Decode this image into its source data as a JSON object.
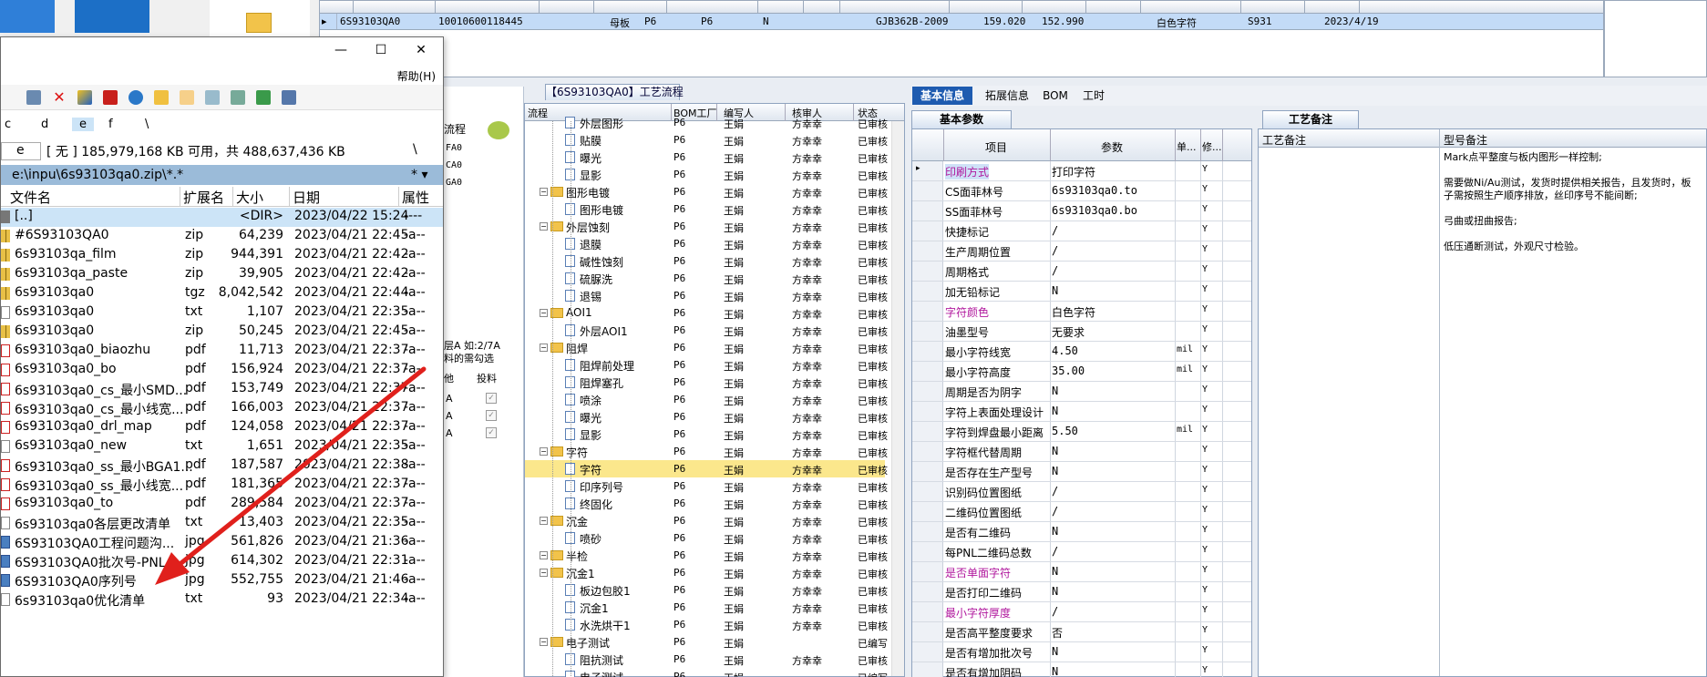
{
  "top_grid": {
    "row": [
      "6S93103QA0",
      "10010600118445",
      "母板",
      "P6",
      "P6",
      "N",
      "GJB362B-2009",
      "159.020",
      "152.990",
      "白色字符",
      "S931",
      "2023/4/19"
    ]
  },
  "flow_tab_title": "【6S93103QA0】工艺流程",
  "mid_left": {
    "label_flow": "流程",
    "codes": [
      "FA0",
      "CA0",
      "GA0"
    ],
    "hint1": "层A 如:2/7A",
    "hint2": "料的需勾选",
    "col_a": "他",
    "col_b": "投料",
    "rows": [
      "A",
      "A",
      "A"
    ]
  },
  "tree": {
    "headers": [
      "流程",
      "BOM工厂",
      "编写人",
      "核审人",
      "状态"
    ],
    "rows": [
      {
        "indent": 2,
        "type": "file",
        "name": "外层图形",
        "f": "P6",
        "w": "王娟",
        "r": "方幸幸",
        "s": "已审核",
        "partial": true
      },
      {
        "indent": 2,
        "type": "file",
        "name": "贴膜",
        "f": "P6",
        "w": "王娟",
        "r": "方幸幸",
        "s": "已审核"
      },
      {
        "indent": 2,
        "type": "file",
        "name": "曝光",
        "f": "P6",
        "w": "王娟",
        "r": "方幸幸",
        "s": "已审核"
      },
      {
        "indent": 2,
        "type": "file",
        "name": "显影",
        "f": "P6",
        "w": "王娟",
        "r": "方幸幸",
        "s": "已审核"
      },
      {
        "indent": 1,
        "type": "folder",
        "name": "图形电镀",
        "f": "P6",
        "w": "王娟",
        "r": "方幸幸",
        "s": "已审核"
      },
      {
        "indent": 2,
        "type": "file",
        "name": "图形电镀",
        "f": "P6",
        "w": "王娟",
        "r": "方幸幸",
        "s": "已审核"
      },
      {
        "indent": 1,
        "type": "folder",
        "name": "外层蚀刻",
        "f": "P6",
        "w": "王娟",
        "r": "方幸幸",
        "s": "已审核"
      },
      {
        "indent": 2,
        "type": "file",
        "name": "退膜",
        "f": "P6",
        "w": "王娟",
        "r": "方幸幸",
        "s": "已审核"
      },
      {
        "indent": 2,
        "type": "file",
        "name": "碱性蚀刻",
        "f": "P6",
        "w": "王娟",
        "r": "方幸幸",
        "s": "已审核"
      },
      {
        "indent": 2,
        "type": "file",
        "name": "硫脲洗",
        "f": "P6",
        "w": "王娟",
        "r": "方幸幸",
        "s": "已审核"
      },
      {
        "indent": 2,
        "type": "file",
        "name": "退锡",
        "f": "P6",
        "w": "王娟",
        "r": "方幸幸",
        "s": "已审核"
      },
      {
        "indent": 1,
        "type": "folder",
        "name": "AOI1",
        "f": "P6",
        "w": "王娟",
        "r": "方幸幸",
        "s": "已审核"
      },
      {
        "indent": 2,
        "type": "file",
        "name": "外层AOI1",
        "f": "P6",
        "w": "王娟",
        "r": "方幸幸",
        "s": "已审核"
      },
      {
        "indent": 1,
        "type": "folder",
        "name": "阻焊",
        "f": "P6",
        "w": "王娟",
        "r": "方幸幸",
        "s": "已审核"
      },
      {
        "indent": 2,
        "type": "file",
        "name": "阻焊前处理",
        "f": "P6",
        "w": "王娟",
        "r": "方幸幸",
        "s": "已审核"
      },
      {
        "indent": 2,
        "type": "file",
        "name": "阻焊塞孔",
        "f": "P6",
        "w": "王娟",
        "r": "方幸幸",
        "s": "已审核"
      },
      {
        "indent": 2,
        "type": "file",
        "name": "喷涂",
        "f": "P6",
        "w": "王娟",
        "r": "方幸幸",
        "s": "已审核"
      },
      {
        "indent": 2,
        "type": "file",
        "name": "曝光",
        "f": "P6",
        "w": "王娟",
        "r": "方幸幸",
        "s": "已审核"
      },
      {
        "indent": 2,
        "type": "file",
        "name": "显影",
        "f": "P6",
        "w": "王娟",
        "r": "方幸幸",
        "s": "已审核"
      },
      {
        "indent": 1,
        "type": "folder",
        "name": "字符",
        "f": "P6",
        "w": "王娟",
        "r": "方幸幸",
        "s": "已审核"
      },
      {
        "indent": 2,
        "type": "file",
        "name": "字符",
        "f": "P6",
        "w": "王娟",
        "r": "方幸幸",
        "s": "已审核",
        "sel": true
      },
      {
        "indent": 2,
        "type": "file",
        "name": "印序列号",
        "f": "P6",
        "w": "王娟",
        "r": "方幸幸",
        "s": "已审核"
      },
      {
        "indent": 2,
        "type": "file",
        "name": "终固化",
        "f": "P6",
        "w": "王娟",
        "r": "方幸幸",
        "s": "已审核"
      },
      {
        "indent": 1,
        "type": "folder",
        "name": "沉金",
        "f": "P6",
        "w": "王娟",
        "r": "方幸幸",
        "s": "已审核"
      },
      {
        "indent": 2,
        "type": "file",
        "name": "喷砂",
        "f": "P6",
        "w": "王娟",
        "r": "方幸幸",
        "s": "已审核"
      },
      {
        "indent": 1,
        "type": "folder",
        "name": "半检",
        "f": "P6",
        "w": "王娟",
        "r": "方幸幸",
        "s": "已审核"
      },
      {
        "indent": 1,
        "type": "folder",
        "name": "沉金1",
        "f": "P6",
        "w": "王娟",
        "r": "方幸幸",
        "s": "已审核"
      },
      {
        "indent": 2,
        "type": "file",
        "name": "板边包胶1",
        "f": "P6",
        "w": "王娟",
        "r": "方幸幸",
        "s": "已审核"
      },
      {
        "indent": 2,
        "type": "file",
        "name": "沉金1",
        "f": "P6",
        "w": "王娟",
        "r": "方幸幸",
        "s": "已审核"
      },
      {
        "indent": 2,
        "type": "file",
        "name": "水洗烘干1",
        "f": "P6",
        "w": "王娟",
        "r": "方幸幸",
        "s": "已审核"
      },
      {
        "indent": 1,
        "type": "folder",
        "name": "电子测试",
        "f": "P6",
        "w": "王娟",
        "r": "",
        "s": "已编写"
      },
      {
        "indent": 2,
        "type": "file",
        "name": "阻抗测试",
        "f": "P6",
        "w": "王娟",
        "r": "方幸幸",
        "s": "已审核"
      },
      {
        "indent": 2,
        "type": "file",
        "name": "电子测试",
        "f": "P6",
        "w": "王娟",
        "r": "",
        "s": "已编写"
      }
    ]
  },
  "right_tabs": [
    "基本信息",
    "拓展信息",
    "BOM",
    "工时"
  ],
  "sub_tab_basic": "基本参数",
  "sub_tab_remarks": "工艺备注",
  "params": {
    "headers": [
      "项目",
      "参数",
      "单...",
      "修..."
    ],
    "rows": [
      {
        "n": "印刷方式",
        "v": "打印字符",
        "u": "",
        "y": "Y",
        "mag": true
      },
      {
        "n": "CS面菲林号",
        "v": "6s93103qa0.to",
        "u": "",
        "y": "Y"
      },
      {
        "n": "SS面菲林号",
        "v": "6s93103qa0.bo",
        "u": "",
        "y": "Y"
      },
      {
        "n": "快捷标记",
        "v": "/",
        "u": "",
        "y": "Y"
      },
      {
        "n": "生产周期位置",
        "v": "/",
        "u": "",
        "y": "Y"
      },
      {
        "n": "周期格式",
        "v": "/",
        "u": "",
        "y": "Y"
      },
      {
        "n": "加无铅标记",
        "v": "N",
        "u": "",
        "y": "Y"
      },
      {
        "n": "字符颜色",
        "v": "白色字符",
        "u": "",
        "y": "Y",
        "mag": true
      },
      {
        "n": "油墨型号",
        "v": "无要求",
        "u": "",
        "y": "Y"
      },
      {
        "n": "最小字符线宽",
        "v": "4.50",
        "u": "mil",
        "y": "Y"
      },
      {
        "n": "最小字符高度",
        "v": "35.00",
        "u": "mil",
        "y": "Y"
      },
      {
        "n": "周期是否为阴字",
        "v": "N",
        "u": "",
        "y": "Y"
      },
      {
        "n": "字符上表面处理设计",
        "v": "N",
        "u": "",
        "y": "Y"
      },
      {
        "n": "字符到焊盘最小距离",
        "v": "5.50",
        "u": "mil",
        "y": "Y"
      },
      {
        "n": "字符框代替周期",
        "v": "N",
        "u": "",
        "y": "Y"
      },
      {
        "n": "是否存在生产型号",
        "v": "N",
        "u": "",
        "y": "Y"
      },
      {
        "n": "识别码位置图纸",
        "v": "/",
        "u": "",
        "y": "Y"
      },
      {
        "n": "二维码位置图纸",
        "v": "/",
        "u": "",
        "y": "Y"
      },
      {
        "n": "是否有二维码",
        "v": "N",
        "u": "",
        "y": "Y"
      },
      {
        "n": "每PNL二维码总数",
        "v": "/",
        "u": "",
        "y": "Y"
      },
      {
        "n": "是否单面字符",
        "v": "N",
        "u": "",
        "y": "Y",
        "mag": true
      },
      {
        "n": "是否打印二维码",
        "v": "N",
        "u": "",
        "y": "Y"
      },
      {
        "n": "最小字符厚度",
        "v": "/",
        "u": "",
        "y": "Y",
        "mag": true
      },
      {
        "n": "是否高平整度要求",
        "v": "否",
        "u": "",
        "y": "Y"
      },
      {
        "n": "是否有增加批次号",
        "v": "N",
        "u": "",
        "y": "Y"
      },
      {
        "n": "是否有增加阴码",
        "v": "N",
        "u": "",
        "y": "Y"
      }
    ]
  },
  "remarks": {
    "col1": "工艺备注",
    "col2": "型号备注",
    "lines": [
      "Mark点平整度与板内图形一样控制;",
      "需要做Ni/Au测试，发货时提供相关报告，且发货时，板子需按照生产顺序排放，丝印序号不能间断;",
      "弓曲或扭曲报告;",
      "低压通断测试，外观尺寸检验。"
    ]
  },
  "file_manager": {
    "menu_help": "帮助(H)",
    "drives": [
      "c",
      "d",
      "e",
      "f",
      "\\"
    ],
    "drive_sel": "e",
    "free_space": "[ 无 ]  185,979,168 KB 可用，共 488,637,436 KB",
    "path": "e:\\inpu\\6s93103qa0.zip\\*.*",
    "path_right": "* ▾",
    "columns": [
      "文件名",
      "扩展名",
      "大小",
      "日期",
      "属性"
    ],
    "rows": [
      {
        "n": "[..]",
        "e": "",
        "s": "<DIR>",
        "d": "2023/04/22 15:24",
        "a": "----",
        "t": "dir",
        "sel": true
      },
      {
        "n": "#6S93103QA0",
        "e": "zip",
        "s": "64,239",
        "d": "2023/04/21 22:45",
        "a": "-a--",
        "t": "zip"
      },
      {
        "n": "6s93103qa_film",
        "e": "zip",
        "s": "944,391",
        "d": "2023/04/21 22:42",
        "a": "-a--",
        "t": "zip"
      },
      {
        "n": "6s93103qa_paste",
        "e": "zip",
        "s": "39,905",
        "d": "2023/04/21 22:42",
        "a": "-a--",
        "t": "zip"
      },
      {
        "n": "6s93103qa0",
        "e": "tgz",
        "s": "8,042,542",
        "d": "2023/04/21 22:44",
        "a": "-a--",
        "t": "zip"
      },
      {
        "n": "6s93103qa0",
        "e": "txt",
        "s": "1,107",
        "d": "2023/04/21 22:35",
        "a": "-a--",
        "t": "txt"
      },
      {
        "n": "6s93103qa0",
        "e": "zip",
        "s": "50,245",
        "d": "2023/04/21 22:45",
        "a": "-a--",
        "t": "zip"
      },
      {
        "n": "6s93103qa0_biaozhu",
        "e": "pdf",
        "s": "11,713",
        "d": "2023/04/21 22:37",
        "a": "-a--",
        "t": "pdf"
      },
      {
        "n": "6s93103qa0_bo",
        "e": "pdf",
        "s": "156,924",
        "d": "2023/04/21 22:37",
        "a": "-a--",
        "t": "pdf"
      },
      {
        "n": "6s93103qa0_cs_最小SMD...",
        "e": "pdf",
        "s": "153,749",
        "d": "2023/04/21 22:37",
        "a": "-a--",
        "t": "pdf"
      },
      {
        "n": "6s93103qa0_cs_最小线宽...",
        "e": "pdf",
        "s": "166,003",
        "d": "2023/04/21 22:37",
        "a": "-a--",
        "t": "pdf"
      },
      {
        "n": "6s93103qa0_drl_map",
        "e": "pdf",
        "s": "124,058",
        "d": "2023/04/21 22:37",
        "a": "-a--",
        "t": "pdf"
      },
      {
        "n": "6s93103qa0_new",
        "e": "txt",
        "s": "1,651",
        "d": "2023/04/21 22:35",
        "a": "-a--",
        "t": "txt"
      },
      {
        "n": "6s93103qa0_ss_最小BGA1...",
        "e": "pdf",
        "s": "187,587",
        "d": "2023/04/21 22:38",
        "a": "-a--",
        "t": "pdf"
      },
      {
        "n": "6s93103qa0_ss_最小线宽...",
        "e": "pdf",
        "s": "181,365",
        "d": "2023/04/21 22:37",
        "a": "-a--",
        "t": "pdf"
      },
      {
        "n": "6s93103qa0_to",
        "e": "pdf",
        "s": "289,584",
        "d": "2023/04/21 22:37",
        "a": "-a--",
        "t": "pdf"
      },
      {
        "n": "6s93103qa0各层更改清单",
        "e": "txt",
        "s": "13,403",
        "d": "2023/04/21 22:35",
        "a": "-a--",
        "t": "txt"
      },
      {
        "n": "6S93103QA0工程问题沟...",
        "e": "jpg",
        "s": "561,826",
        "d": "2023/04/21 21:36",
        "a": "-a--",
        "t": "jpg"
      },
      {
        "n": "6S93103QA0批次号-PNL...",
        "e": "jpg",
        "s": "614,302",
        "d": "2023/04/21 22:31",
        "a": "-a--",
        "t": "jpg"
      },
      {
        "n": "6S93103QA0序列号",
        "e": "jpg",
        "s": "552,755",
        "d": "2023/04/21 21:46",
        "a": "-a--",
        "t": "jpg"
      },
      {
        "n": "6s93103qa0优化清单",
        "e": "txt",
        "s": "93",
        "d": "2023/04/21 22:34",
        "a": "-a--",
        "t": "txt"
      }
    ]
  },
  "colors": {
    "accent": "#1e5bb0",
    "selected_row": "#fbe78c",
    "magenta_label": "#b0179d",
    "arrow": "#e0201c"
  }
}
